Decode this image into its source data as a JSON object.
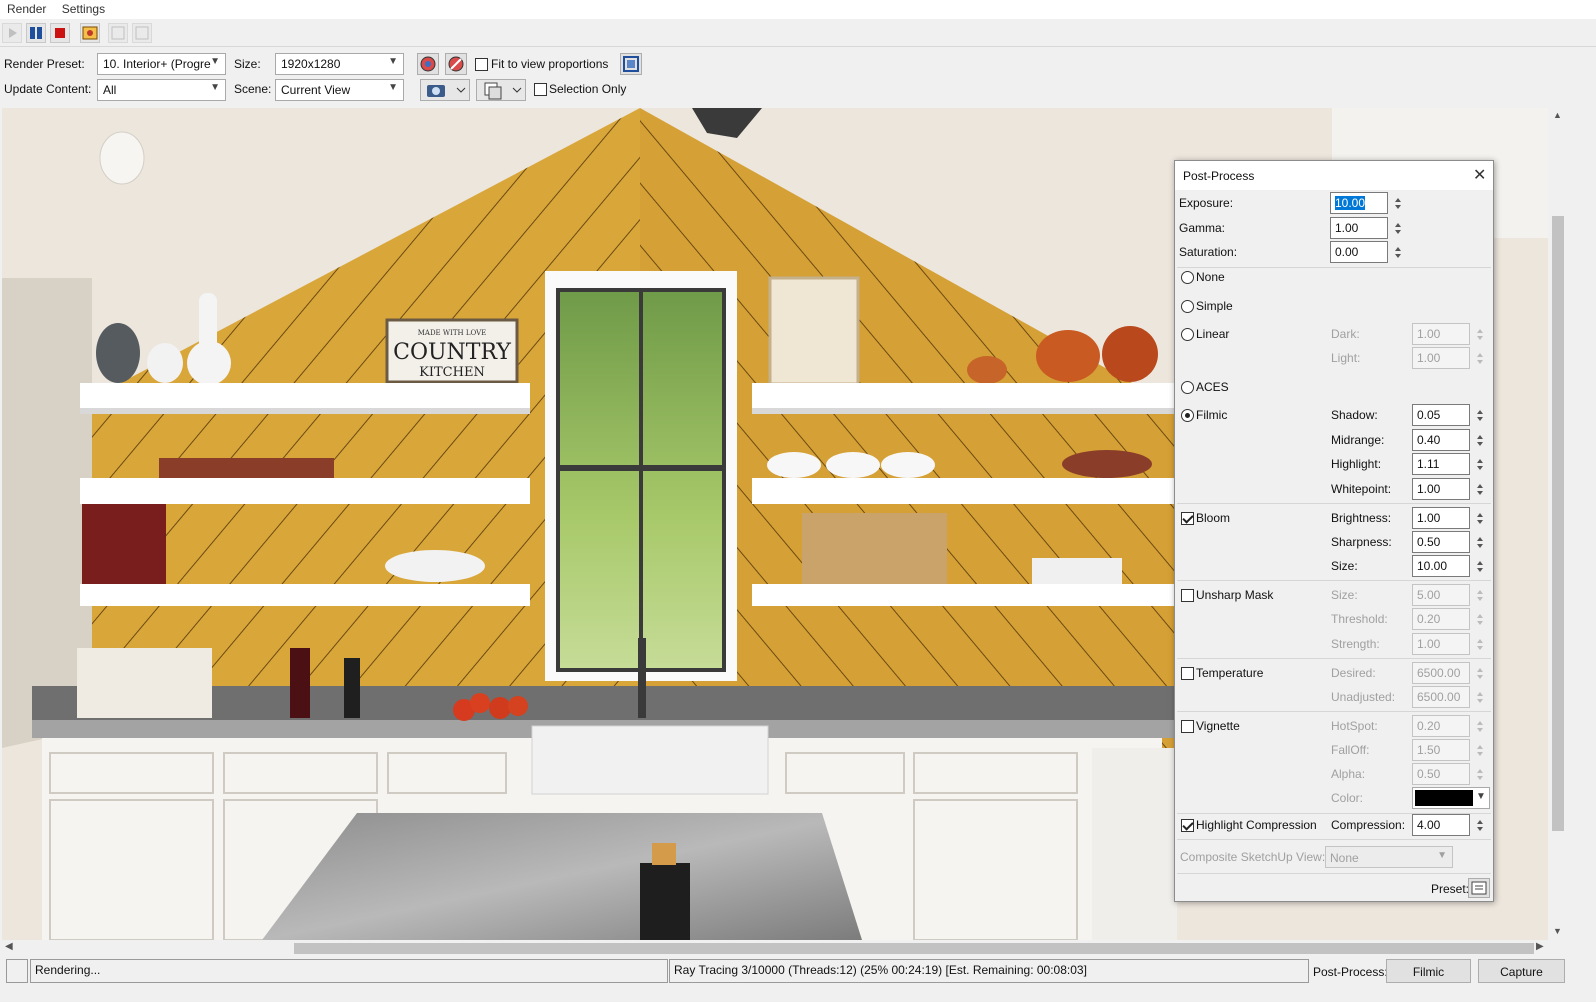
{
  "menu": {
    "items": [
      "Render",
      "Settings"
    ]
  },
  "controls": {
    "render_preset_label": "Render Preset:",
    "render_preset_value": "10. Interior+ (Progre",
    "size_label": "Size:",
    "size_value": "1920x1280",
    "fit_label": "Fit to view proportions",
    "update_label": "Update Content:",
    "update_value": "All",
    "scene_label": "Scene:",
    "scene_value": "Current View",
    "selection_label": "Selection Only"
  },
  "render_scene": {
    "sign_top": "MADE WITH LOVE",
    "sign_main": "COUNTRY",
    "sign_sub": "KITCHEN"
  },
  "postprocess": {
    "title": "Post-Process",
    "exposure": {
      "label": "Exposure:",
      "value": "10.00"
    },
    "gamma": {
      "label": "Gamma:",
      "value": "1.00"
    },
    "saturation": {
      "label": "Saturation:",
      "value": "0.00"
    },
    "tonemap": {
      "none": "None",
      "simple": "Simple",
      "linear": "Linear",
      "dark_label": "Dark:",
      "dark_value": "1.00",
      "light_label": "Light:",
      "light_value": "1.00",
      "aces": "ACES",
      "filmic": "Filmic",
      "selected": "Filmic",
      "shadow_label": "Shadow:",
      "shadow_value": "0.05",
      "midrange_label": "Midrange:",
      "midrange_value": "0.40",
      "highlight_label": "Highlight:",
      "highlight_value": "1.11",
      "whitepoint_label": "Whitepoint:",
      "whitepoint_value": "1.00"
    },
    "bloom": {
      "label": "Bloom",
      "checked": true,
      "brightness_label": "Brightness:",
      "brightness_value": "1.00",
      "sharpness_label": "Sharpness:",
      "sharpness_value": "0.50",
      "size_label": "Size:",
      "size_value": "10.00"
    },
    "unsharp": {
      "label": "Unsharp Mask",
      "checked": false,
      "size_label": "Size:",
      "size_value": "5.00",
      "threshold_label": "Threshold:",
      "threshold_value": "0.20",
      "strength_label": "Strength:",
      "strength_value": "1.00"
    },
    "temperature": {
      "label": "Temperature",
      "checked": false,
      "desired_label": "Desired:",
      "desired_value": "6500.00",
      "unadjusted_label": "Unadjusted:",
      "unadjusted_value": "6500.00"
    },
    "vignette": {
      "label": "Vignette",
      "checked": false,
      "hotspot_label": "HotSpot:",
      "hotspot_value": "0.20",
      "falloff_label": "FallOff:",
      "falloff_value": "1.50",
      "alpha_label": "Alpha:",
      "alpha_value": "0.50",
      "color_label": "Color:",
      "color_value": "#000000"
    },
    "highlight_compression": {
      "label": "Highlight Compression",
      "checked": true,
      "compression_label": "Compression:",
      "compression_value": "4.00"
    },
    "composite_label": "Composite SketchUp View:",
    "composite_value": "None",
    "preset_label": "Preset:"
  },
  "status": {
    "left": "Rendering...",
    "progress": "Ray Tracing 3/10000 (Threads:12) (25% 00:24:19) [Est. Remaining: 00:08:03]",
    "postprocess_label": "Post-Process:",
    "postprocess_button": "Filmic",
    "capture_button": "Capture"
  },
  "colors": {
    "accent": "#0078d7",
    "wall": "#d9a63a",
    "shelf": "#ffffff"
  }
}
